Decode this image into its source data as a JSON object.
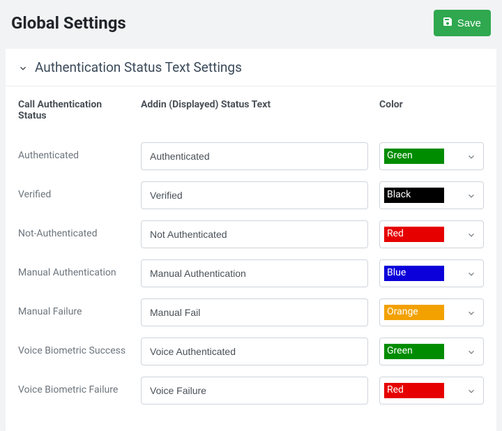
{
  "header": {
    "title": "Global Settings",
    "save_label": "Save"
  },
  "panel": {
    "title": "Authentication Status Text Settings"
  },
  "columns": {
    "status": "Call Authentication Status",
    "text": "Addin (Displayed) Status Text",
    "color": "Color"
  },
  "rows": [
    {
      "status": "Authenticated",
      "text": "Authenticated",
      "color_name": "Green",
      "color_hex": "#008c00"
    },
    {
      "status": "Verified",
      "text": "Verified",
      "color_name": "Black",
      "color_hex": "#000000"
    },
    {
      "status": "Not-Authenticated",
      "text": "Not Authenticated",
      "color_name": "Red",
      "color_hex": "#e60000"
    },
    {
      "status": "Manual Authentication",
      "text": "Manual Authentication",
      "color_name": "Blue",
      "color_hex": "#0b00d9"
    },
    {
      "status": "Manual Failure",
      "text": "Manual Fail",
      "color_name": "Orange",
      "color_hex": "#f2a100"
    },
    {
      "status": "Voice Biometric Success",
      "text": "Voice Authenticated",
      "color_name": "Green",
      "color_hex": "#008c00"
    },
    {
      "status": "Voice Biometric Failure",
      "text": "Voice Failure",
      "color_name": "Red",
      "color_hex": "#e60000"
    }
  ]
}
